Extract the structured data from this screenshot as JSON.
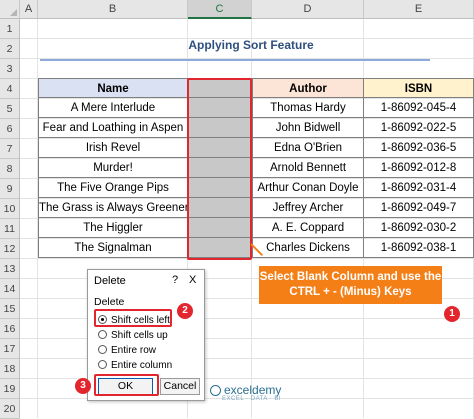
{
  "columns": [
    "A",
    "B",
    "C",
    "D",
    "E"
  ],
  "selected_column": "C",
  "rows": [
    "1",
    "2",
    "3",
    "4",
    "5",
    "6",
    "7",
    "8",
    "9",
    "10",
    "11",
    "12",
    "13",
    "14",
    "15",
    "16",
    "17",
    "18",
    "19",
    "20"
  ],
  "title": "Applying Sort Feature",
  "table": {
    "headers": [
      "Name",
      "",
      "Author",
      "ISBN"
    ],
    "rows": [
      {
        "name": "A Mere Interlude",
        "author": "Thomas Hardy",
        "isbn": "1-86092-045-4"
      },
      {
        "name": "Fear and Loathing in Aspen",
        "author": "John Bidwell",
        "isbn": "1-86092-022-5"
      },
      {
        "name": "Irish Revel",
        "author": "Edna O'Brien",
        "isbn": "1-86092-036-5"
      },
      {
        "name": "Murder!",
        "author": "Arnold Bennett",
        "isbn": "1-86092-012-8"
      },
      {
        "name": "The Five Orange Pips",
        "author": "Arthur Conan Doyle",
        "isbn": "1-86092-031-4"
      },
      {
        "name": "The Grass is Always Greener",
        "author": "Jeffrey Archer",
        "isbn": "1-86092-049-7"
      },
      {
        "name": "The Higgler",
        "author": "A. E. Coppard",
        "isbn": "1-86092-030-2"
      },
      {
        "name": "The Signalman",
        "author": "Charles Dickens",
        "isbn": "1-86092-038-1"
      }
    ]
  },
  "callout": {
    "text": "Select Blank Column and use the CTRL + - (Minus) Keys",
    "marker": "1"
  },
  "dialog": {
    "title": "Delete",
    "help": "?",
    "close": "X",
    "group_label": "Delete",
    "options": [
      "Shift cells left",
      "Shift cells up",
      "Entire row",
      "Entire column"
    ],
    "selected_option": "Shift cells left",
    "ok_label": "OK",
    "cancel_label": "Cancel",
    "marker_option": "2",
    "marker_ok": "3"
  },
  "watermark": {
    "name": "exceldemy",
    "tagline": "EXCEL · DATA · BI"
  },
  "colors": {
    "accent_red": "#e3262d",
    "callout_orange": "#f57f17",
    "header_blue": "#d9e1f2",
    "header_orange": "#fce4d6",
    "header_yellow": "#fff2cc"
  }
}
